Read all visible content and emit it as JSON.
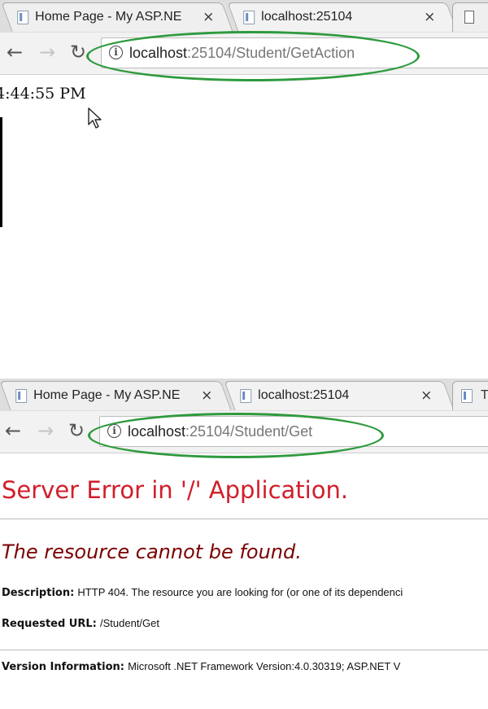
{
  "screenshot1": {
    "tabs": [
      {
        "label": "Home Page - My ASP.NE",
        "close": "×"
      },
      {
        "label": "localhost:25104",
        "close": "×"
      }
    ],
    "url": {
      "host": "localhost",
      "path": ":25104/Student/GetAction"
    },
    "page": {
      "time_text": "4:44:55 PM"
    }
  },
  "screenshot2": {
    "tabs": [
      {
        "label": "Home Page - My ASP.NE",
        "close": "×"
      },
      {
        "label": "localhost:25104",
        "close": "×"
      },
      {
        "label": "T"
      }
    ],
    "url": {
      "host": "localhost",
      "path": ":25104/Student/Get"
    },
    "error": {
      "title": "Server Error in '/' Application.",
      "subtitle": "The resource cannot be found.",
      "description_label": "Description:",
      "description_text": "HTTP 404. The resource you are looking for (or one of its dependenci",
      "requested_url_label": "Requested URL:",
      "requested_url_value": "/Student/Get",
      "version_label": "Version Information:",
      "version_value": "Microsoft .NET Framework Version:4.0.30319; ASP.NET V"
    }
  },
  "icons": {
    "back": "arrow-left-icon",
    "forward": "arrow-right-icon",
    "reload": "reload-icon",
    "info": "info-icon",
    "favicon": "page-favicon-icon",
    "document": "document-icon",
    "cursor": "mouse-pointer-icon"
  },
  "colors": {
    "highlight": "#2e9a3d",
    "error_title": "#d01f2b",
    "error_subtitle": "#7a0000"
  }
}
